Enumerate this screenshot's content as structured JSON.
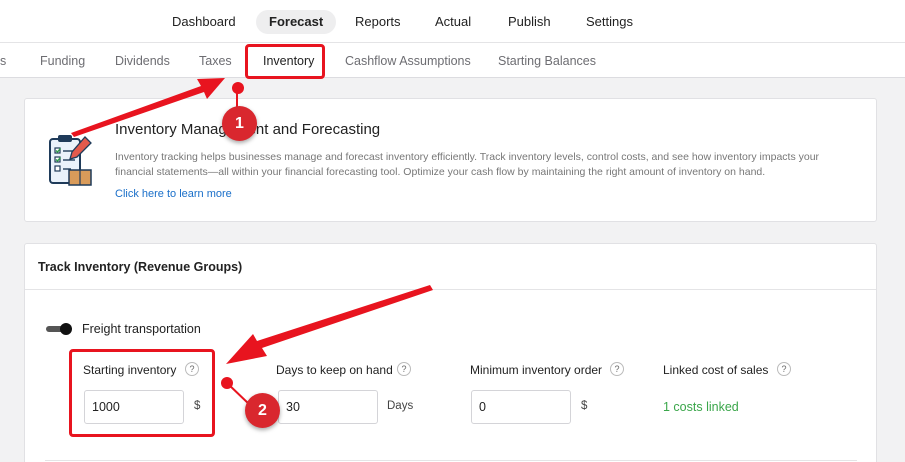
{
  "topnav": {
    "items": [
      "Dashboard",
      "Forecast",
      "Reports",
      "Actual",
      "Publish",
      "Settings"
    ]
  },
  "subnav": {
    "tabs": [
      "s",
      "Funding",
      "Dividends",
      "Taxes",
      "Inventory",
      "Cashflow Assumptions",
      "Starting Balances"
    ]
  },
  "intro": {
    "title": "Inventory Management and Forecasting",
    "description": "Inventory tracking helps businesses manage and forecast inventory efficiently. Track inventory levels, control costs, and see how inventory impacts your financial statements—all within your financial forecasting tool. Optimize your cash flow by maintaining the right amount of inventory on hand.",
    "link": "Click here to learn more"
  },
  "track": {
    "title": "Track Inventory (Revenue Groups)",
    "group": "Freight transportation",
    "fields": [
      {
        "label": "Starting inventory",
        "help": "?",
        "value": "1000",
        "unit": "$"
      },
      {
        "label": "Days to keep on hand",
        "help": "?",
        "value": "30",
        "unit": "Days"
      },
      {
        "label": "Minimum inventory order",
        "help": "?",
        "value": "0",
        "unit": "$"
      },
      {
        "label": "Linked cost of sales",
        "help": "?",
        "value": "1 costs linked"
      }
    ]
  },
  "annotations": {
    "badges": [
      "1",
      "2"
    ],
    "color": "#e8141f"
  }
}
